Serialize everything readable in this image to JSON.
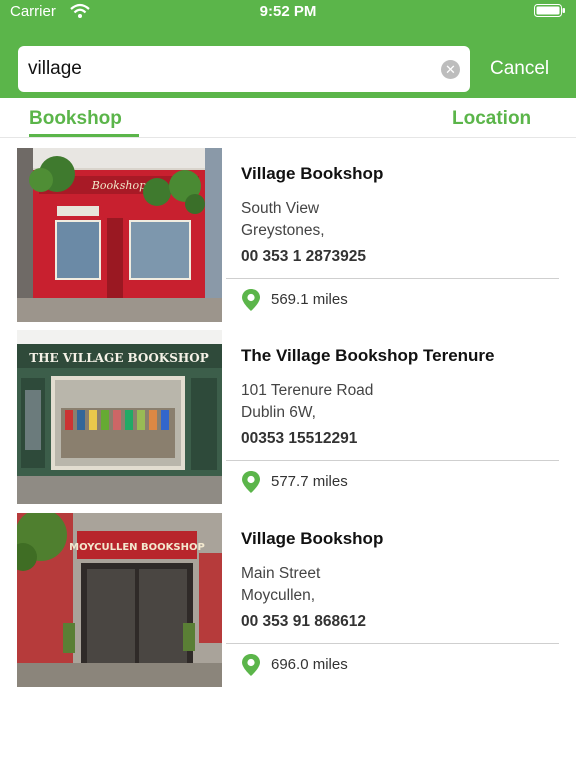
{
  "status_bar": {
    "carrier": "Carrier",
    "time": "9:52 PM"
  },
  "search": {
    "value": "village",
    "cancel_label": "Cancel"
  },
  "tabs": [
    {
      "label": "Bookshop",
      "active": true
    },
    {
      "label": "Location",
      "active": false
    }
  ],
  "results": [
    {
      "name": "Village Bookshop",
      "address_line1": "South View",
      "address_line2": "Greystones,",
      "phone": "00 353 1 2873925",
      "distance": "569.1 miles",
      "sign": "Bookshop"
    },
    {
      "name": "The Village Bookshop Terenure",
      "address_line1": "101 Terenure Road",
      "address_line2": "Dublin 6W,",
      "phone": "00353 15512291",
      "distance": "577.7 miles",
      "sign": "THE VILLAGE BOOKSHOP"
    },
    {
      "name": "Village Bookshop",
      "address_line1": "Main Street",
      "address_line2": "Moycullen,",
      "phone": "00 353 91 868612",
      "distance": "696.0 miles",
      "sign": "MOYCULLEN BOOKSHOP"
    }
  ],
  "colors": {
    "accent": "#5bb54a",
    "shop1": "#c8202f",
    "shop2": "#3c5e4a",
    "shop3": "#b8262c"
  },
  "icons": {
    "wifi": "wifi-icon",
    "battery": "battery-icon",
    "clear": "clear-icon",
    "pin": "location-pin-icon"
  }
}
